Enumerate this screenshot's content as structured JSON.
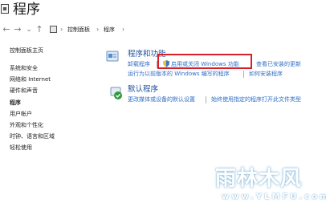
{
  "window": {
    "title": "程序"
  },
  "address_bar": {
    "back": "←",
    "forward": "→",
    "dropdown": "⌄",
    "up": "↑",
    "separator": "›",
    "crumbs": [
      "控制面板",
      "程序"
    ]
  },
  "sidebar": {
    "items": [
      {
        "label": "控制面板主页"
      },
      {
        "label": "系统和安全"
      },
      {
        "label": "网络和 Internet"
      },
      {
        "label": "硬件和声音"
      },
      {
        "label": "程序"
      },
      {
        "label": "用户帐户"
      },
      {
        "label": "外观和个性化"
      },
      {
        "label": "时钟、语言和区域"
      },
      {
        "label": "轻松使用"
      }
    ]
  },
  "programs_features": {
    "title": "程序和功能",
    "uninstall": "卸载程序",
    "windows_features": "启用或关闭 Windows 功能",
    "view_updates": "查看已安装的更新",
    "run_old_programs": "运行为以前版本的 Windows 编写的程序",
    "how_to_install": "如何安装程序"
  },
  "default_programs": {
    "title": "默认程序",
    "change_defaults": "更改媒体或设备的默认设置",
    "always_open": "始终使用指定的程序打开此文件类型"
  },
  "watermark": {
    "main": "雨林木风",
    "url": "www.YLMFU.com"
  },
  "colors": {
    "link": "#2f6fc4",
    "section_title": "#1c4f9c",
    "highlight": "#d6212b"
  }
}
